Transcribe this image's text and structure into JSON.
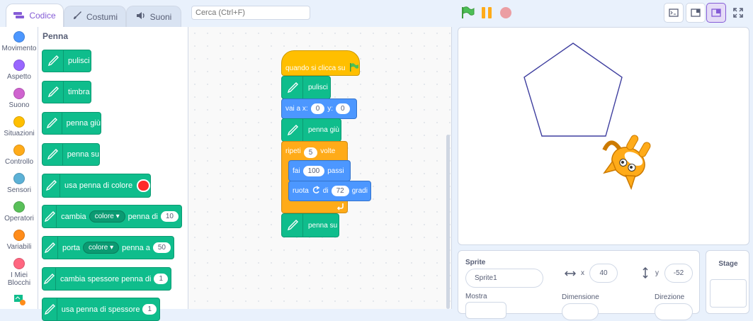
{
  "tabs": [
    {
      "label": "Codice"
    },
    {
      "label": "Costumi"
    },
    {
      "label": "Suoni"
    }
  ],
  "search": {
    "placeholder": "Cerca (Ctrl+F)"
  },
  "categories": [
    {
      "label": "Movimento",
      "color": "#4c97ff"
    },
    {
      "label": "Aspetto",
      "color": "#9966ff"
    },
    {
      "label": "Suono",
      "color": "#cf63cf"
    },
    {
      "label": "Situazioni",
      "color": "#ffbf00"
    },
    {
      "label": "Controllo",
      "color": "#ffab19"
    },
    {
      "label": "Sensori",
      "color": "#5cb1d6"
    },
    {
      "label": "Operatori",
      "color": "#59c059"
    },
    {
      "label": "Variabili",
      "color": "#ff8c1a"
    },
    {
      "label": "I Miei Blocchi",
      "color": "#ff6680"
    }
  ],
  "palette": {
    "title": "Penna",
    "blocks": {
      "clear": "pulisci",
      "stamp": "timbra",
      "pen_down": "penna giù",
      "pen_up": "penna su",
      "set_color": "usa penna di colore",
      "change_prefix": "cambia",
      "change_dd": "colore",
      "change_mid": "penna di",
      "change_val": "10",
      "set_prefix": "porta",
      "set_dd": "colore",
      "set_mid": "penna a",
      "set_val": "50",
      "change_size": "cambia spessore penna di",
      "change_size_val": "1",
      "set_size": "usa penna di spessore",
      "set_size_val": "1"
    },
    "pen_color": "#ff2a2a"
  },
  "script": {
    "hat": "quando si clicca su",
    "clear": "pulisci",
    "goto_label": "vai a x:",
    "goto_x": "0",
    "goto_y_label": "y:",
    "goto_y": "0",
    "pen_down": "penna giù",
    "repeat_label": "ripeti",
    "repeat_val": "5",
    "repeat_suffix": "volte",
    "move_label": "fai",
    "move_val": "100",
    "move_suffix": "passi",
    "turn_label": "ruota",
    "turn_of": "di",
    "turn_val": "72",
    "turn_suffix": "gradi",
    "pen_up": "penna su"
  },
  "sprite": {
    "section": "Sprite",
    "name": "Sprite1",
    "x_label": "x",
    "x": "40",
    "y_label": "y",
    "y": "-52",
    "show_label": "Mostra",
    "size_label": "Dimensione",
    "direction_label": "Direzione"
  },
  "stage_panel": {
    "label": "Stage"
  },
  "colors": {
    "accent": "#855cd6",
    "pen_line": "#3f3f9f"
  }
}
